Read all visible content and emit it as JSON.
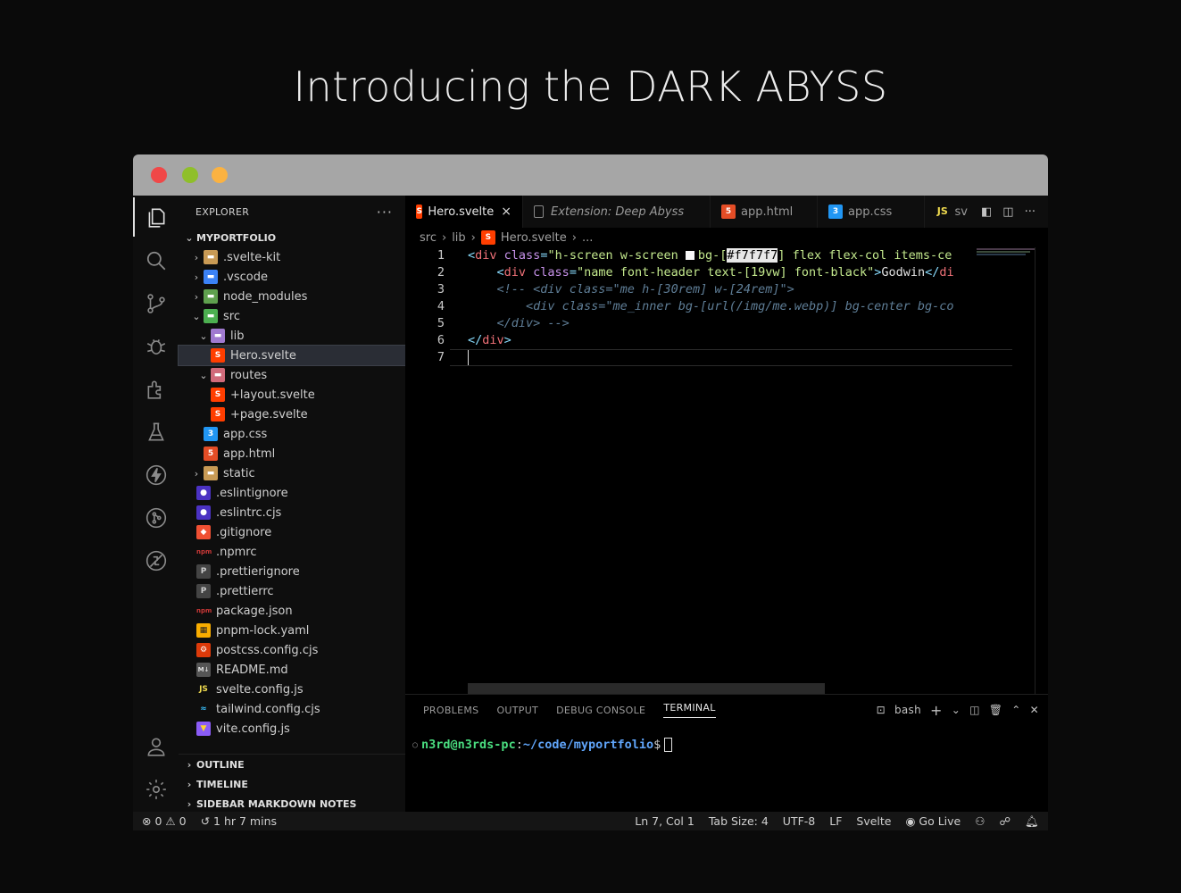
{
  "headline": "Introducing the DARK ABYSS",
  "activity_bar": [
    "files-icon",
    "search-icon",
    "source-control-icon",
    "debug-icon",
    "extensions-icon",
    "testing-icon",
    "lightning-icon",
    "git-graph-icon",
    "remote-icon",
    "account-icon",
    "settings-gear-icon"
  ],
  "sidebar": {
    "title": "EXPLORER",
    "more": "···",
    "project": "MYPORTFOLIO",
    "tree": [
      {
        "label": ".svelte-kit",
        "depth": 0,
        "type": "folder",
        "chevron": "›",
        "icon": "folder"
      },
      {
        "label": ".vscode",
        "depth": 0,
        "type": "folder",
        "chevron": "›",
        "icon": "folder-vscode"
      },
      {
        "label": "node_modules",
        "depth": 0,
        "type": "folder",
        "chevron": "›",
        "icon": "folder-node"
      },
      {
        "label": "src",
        "depth": 0,
        "type": "folder",
        "chevron": "⌄",
        "icon": "folder-src"
      },
      {
        "label": "lib",
        "depth": 1,
        "type": "folder",
        "chevron": "⌄",
        "icon": "folder-lib"
      },
      {
        "label": "Hero.svelte",
        "depth": 3,
        "type": "file",
        "icon": "svelte",
        "selected": true
      },
      {
        "label": "routes",
        "depth": 1,
        "type": "folder",
        "chevron": "⌄",
        "icon": "folder-routes"
      },
      {
        "label": "+layout.svelte",
        "depth": 3,
        "type": "file",
        "icon": "svelte"
      },
      {
        "label": "+page.svelte",
        "depth": 3,
        "type": "file",
        "icon": "svelte"
      },
      {
        "label": "app.css",
        "depth": 2,
        "type": "file",
        "icon": "css"
      },
      {
        "label": "app.html",
        "depth": 2,
        "type": "file",
        "icon": "html"
      },
      {
        "label": "static",
        "depth": 0,
        "type": "folder",
        "chevron": "›",
        "icon": "folder"
      },
      {
        "label": ".eslintignore",
        "depth": 1,
        "type": "file",
        "icon": "eslint"
      },
      {
        "label": ".eslintrc.cjs",
        "depth": 1,
        "type": "file",
        "icon": "eslint"
      },
      {
        "label": ".gitignore",
        "depth": 1,
        "type": "file",
        "icon": "git"
      },
      {
        "label": ".npmrc",
        "depth": 1,
        "type": "file",
        "icon": "npm"
      },
      {
        "label": ".prettierignore",
        "depth": 1,
        "type": "file",
        "icon": "prettier"
      },
      {
        "label": ".prettierrc",
        "depth": 1,
        "type": "file",
        "icon": "prettier"
      },
      {
        "label": "package.json",
        "depth": 1,
        "type": "file",
        "icon": "npm"
      },
      {
        "label": "pnpm-lock.yaml",
        "depth": 1,
        "type": "file",
        "icon": "pnpm"
      },
      {
        "label": "postcss.config.cjs",
        "depth": 1,
        "type": "file",
        "icon": "postcss"
      },
      {
        "label": "README.md",
        "depth": 1,
        "type": "file",
        "icon": "markdown"
      },
      {
        "label": "svelte.config.js",
        "depth": 1,
        "type": "file",
        "icon": "js"
      },
      {
        "label": "tailwind.config.cjs",
        "depth": 1,
        "type": "file",
        "icon": "tailwind"
      },
      {
        "label": "vite.config.js",
        "depth": 1,
        "type": "file",
        "icon": "vite"
      }
    ],
    "sections": [
      "OUTLINE",
      "TIMELINE",
      "SIDEBAR MARKDOWN NOTES"
    ]
  },
  "tabs": [
    {
      "label": "Hero.svelte",
      "icon": "svelte",
      "active": true,
      "close": "×"
    },
    {
      "label": "Extension: Deep Abyss",
      "icon": "file",
      "italic": true
    },
    {
      "label": "app.html",
      "icon": "html"
    },
    {
      "label": "app.css",
      "icon": "css"
    },
    {
      "label": "sv",
      "icon": "js"
    }
  ],
  "breadcrumb": [
    "src",
    "lib",
    "Hero.svelte",
    "..."
  ],
  "code": {
    "line_numbers": [
      "1",
      "2",
      "3",
      "4",
      "5",
      "6",
      "7"
    ],
    "l1": {
      "lt": "<",
      "tag": "div",
      "attr": " class",
      "eq": "=",
      "str1": "\"h-screen w-screen ",
      "str2": "bg-[",
      "hex": "#f7f7f7",
      "str3": "] flex flex-col items-ce"
    },
    "l2": {
      "indent": "    ",
      "lt": "<",
      "tag": "div",
      "attr": " class",
      "eq": "=",
      "str": "\"name font-header text-[19vw] font-black\"",
      "gt": ">",
      "txt": "Godwin",
      "close_lt": "</",
      "close_tag": "di"
    },
    "l3": "    <!-- <div class=\"me h-[30rem] w-[24rem]\">",
    "l4": "        <div class=\"me_inner bg-[url(/img/me.webp)] bg-center bg-co",
    "l5": "    </div> -->",
    "l6": {
      "lt": "</",
      "tag": "div",
      "gt": ">"
    }
  },
  "panel": {
    "tabs": [
      "PROBLEMS",
      "OUTPUT",
      "DEBUG CONSOLE",
      "TERMINAL"
    ],
    "active_tab": "TERMINAL",
    "shell": "bash",
    "prompt_user": "n3rd@n3rds-pc",
    "prompt_colon": ":",
    "prompt_path": "~/code/myportfolio",
    "prompt_end": "$"
  },
  "status": {
    "errors": "0",
    "warnings": "0",
    "time": "1 hr 7 mins",
    "position": "Ln 7, Col 1",
    "tab_size": "Tab Size: 4",
    "encoding": "UTF-8",
    "eol": "LF",
    "language": "Svelte",
    "go_live": "Go Live"
  },
  "colors": {
    "svelte": "#ff3e00",
    "css": "#2196f3",
    "html": "#e44d26",
    "js": "#f0db4f",
    "accent_user": "#4ade80",
    "accent_path": "#60a5fa"
  }
}
